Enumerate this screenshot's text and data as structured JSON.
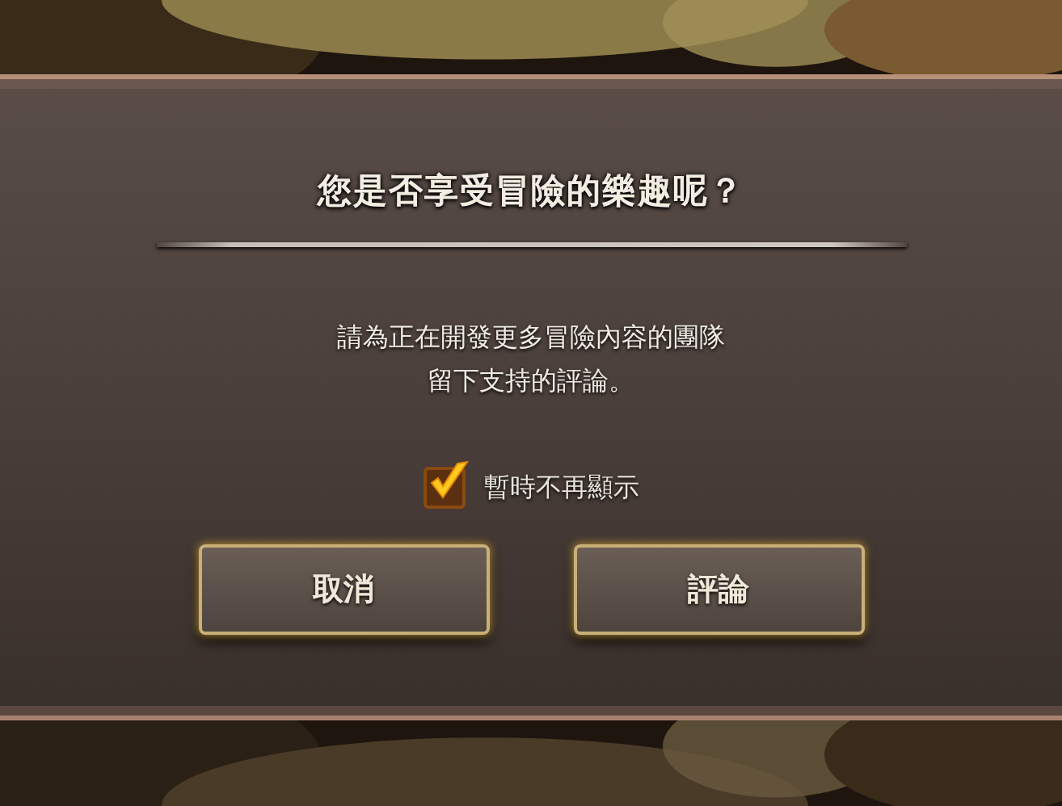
{
  "dialog": {
    "title": "您是否享受冒險的樂趣呢？",
    "message": "請為正在開發更多冒險內容的團隊留下支持的評論。",
    "checkbox": {
      "label": "暫時不再顯示",
      "checked": true
    },
    "buttons": [
      {
        "label": "取消"
      },
      {
        "label": "評論"
      }
    ]
  }
}
